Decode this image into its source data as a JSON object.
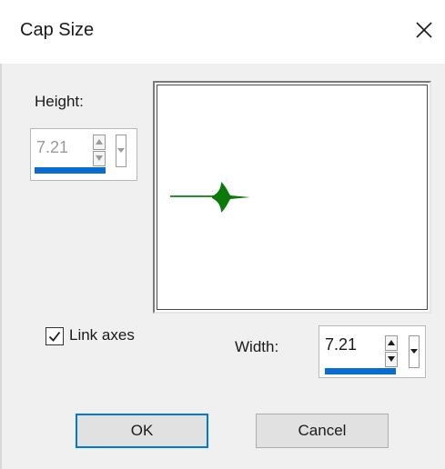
{
  "dialog": {
    "title": "Cap Size",
    "close_icon": "close-icon"
  },
  "height": {
    "label": "Height:",
    "value": "7.21",
    "enabled": false
  },
  "width": {
    "label": "Width:",
    "value": "7.21",
    "enabled": true
  },
  "link_axes": {
    "label": "Link axes",
    "checked": true
  },
  "buttons": {
    "ok": "OK",
    "cancel": "Cancel"
  },
  "colors": {
    "accent": "#0078d7",
    "spin_underline": "#0a6ccf",
    "preview_line": "#2e8b2e",
    "preview_cap": "#0a7a0a"
  }
}
